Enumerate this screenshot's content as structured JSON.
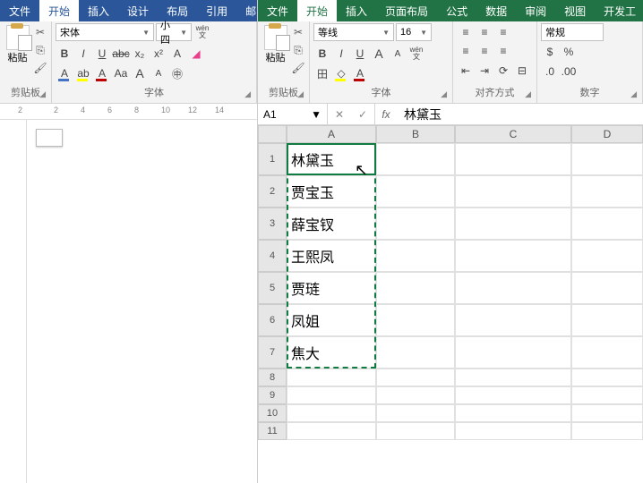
{
  "word": {
    "tabs": [
      "文件",
      "开始",
      "插入",
      "设计",
      "布局",
      "引用",
      "邮"
    ],
    "activeTab": "开始",
    "clipboard": {
      "label": "剪贴板",
      "paste": "粘贴"
    },
    "font": {
      "label": "字体",
      "name": "宋体",
      "size": "小四",
      "buttons": {
        "bold": "B",
        "italic": "I",
        "underline": "U",
        "strike": "abc",
        "sub": "x₂",
        "sup": "x²",
        "clear": "A",
        "case": "Aa",
        "grow": "A",
        "shrink": "A"
      },
      "wen": "wén"
    },
    "ruler_marks": [
      "2",
      "",
      "2",
      "4",
      "6",
      "8",
      "10",
      "12",
      "14"
    ]
  },
  "excel": {
    "tabs": [
      "文件",
      "开始",
      "插入",
      "页面布局",
      "公式",
      "数据",
      "审阅",
      "视图",
      "开发工"
    ],
    "activeTab": "开始",
    "clipboard": {
      "label": "剪贴板",
      "paste": "粘贴"
    },
    "font": {
      "label": "字体",
      "name": "等线",
      "size": "16",
      "buttons": {
        "bold": "B",
        "italic": "I",
        "underline": "U",
        "grow": "A",
        "shrink": "A",
        "border": "田"
      },
      "wen": "wén"
    },
    "align": {
      "label": "对齐方式"
    },
    "number": {
      "label": "数字",
      "format": "常规"
    },
    "name_box": "A1",
    "formula_value": "林黛玉",
    "fx": "fx",
    "columns": [
      "A",
      "B",
      "C",
      "D"
    ],
    "rows": [
      {
        "n": 1,
        "a": "林黛玉"
      },
      {
        "n": 2,
        "a": "贾宝玉"
      },
      {
        "n": 3,
        "a": "薛宝钗"
      },
      {
        "n": 4,
        "a": "王熙凤"
      },
      {
        "n": 5,
        "a": "贾琏"
      },
      {
        "n": 6,
        "a": "凤姐"
      },
      {
        "n": 7,
        "a": "焦大"
      },
      {
        "n": 8,
        "a": ""
      },
      {
        "n": 9,
        "a": ""
      },
      {
        "n": 10,
        "a": ""
      },
      {
        "n": 11,
        "a": ""
      }
    ],
    "selection": {
      "cell": "A1",
      "marquee": "A1:A7"
    }
  }
}
